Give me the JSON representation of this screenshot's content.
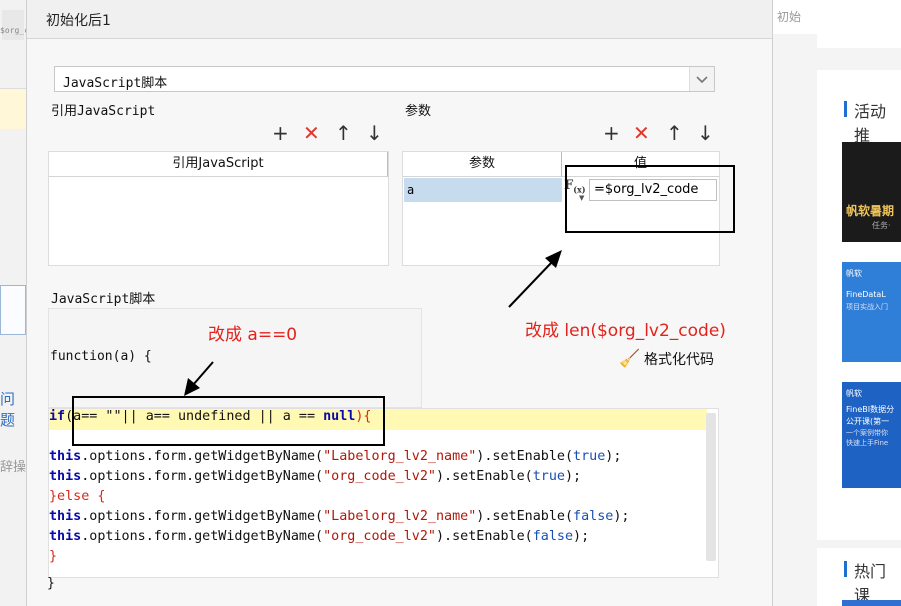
{
  "background": {
    "right_tab": "初始",
    "section_activity": "活动推",
    "section_hot": "热门课",
    "thumb1_text": "帆软暑期",
    "thumb1_sub": "任务·",
    "thumb2_brand": "帆软",
    "thumb2_line1": "FineDataL",
    "thumb2_line2": "项目实战入门",
    "thumb3_brand": "帆软",
    "thumb3_line1": "FineBI数据分",
    "thumb3_line2": "公开课(第一",
    "thumb3_line3": "一个案例带你",
    "thumb3_line4": "快速上手Fine",
    "left_frag1": "$org_c",
    "left_frag2": "问题",
    "left_frag3": "辞操"
  },
  "dialog": {
    "title": "初始化后1",
    "select_value": "JavaScript脚本",
    "ref_js_label": "引用JavaScript",
    "params_label": "参数",
    "ref_js_header": "引用JavaScript",
    "params_col_param": "参数",
    "params_col_value": "值",
    "param_name": "a",
    "param_value": "=$org_lv2_code",
    "script_label": "JavaScript脚本",
    "function_header": "function(a) {",
    "format_code": "格式化代码",
    "closing_brace": "}"
  },
  "code": {
    "l1_kw": "if",
    "l1_rest": "(a== \"\"|| a== undefined || a == ",
    "l1_null": "null",
    "l1_end": "){",
    "l3_obj": "this",
    "l3_mid": ".options.form.getWidgetByName(",
    "l3_str": "\"Labelorg_lv2_name\"",
    "l3_call": ").setEnable(",
    "l3_val": "true",
    "l3_end": ");",
    "l4_obj": "this",
    "l4_mid": ".options.form.getWidgetByName(",
    "l4_str": "\"org_code_lv2\"",
    "l4_call": ").setEnable(",
    "l4_val": "true",
    "l4_end": ");",
    "l5": "}else {",
    "l6_obj": "this",
    "l6_mid": ".options.form.getWidgetByName(",
    "l6_str": "\"Labelorg_lv2_name\"",
    "l6_call": ").setEnable(",
    "l6_val": "false",
    "l6_end": ");",
    "l7_obj": "this",
    "l7_mid": ".options.form.getWidgetByName(",
    "l7_str": "\"org_code_lv2\"",
    "l7_call": ").setEnable(",
    "l7_val": "false",
    "l7_end": ");",
    "l8": "}"
  },
  "annotations": {
    "change_a": "改成 a==0",
    "change_len": "改成  len($org_lv2_code)"
  },
  "icons": {
    "add": "+",
    "delete": "✕",
    "up": "↑",
    "down": "↓",
    "fx": "F(x)",
    "brush": "🧹"
  }
}
